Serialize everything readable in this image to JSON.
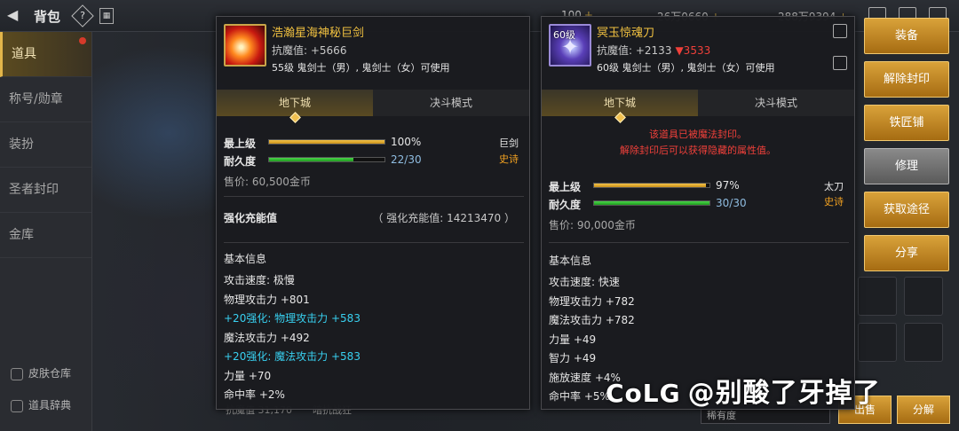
{
  "header": {
    "title": "背包",
    "help_glyph": "?",
    "currencies": [
      "100",
      "26万0660",
      "288万9394"
    ]
  },
  "sidebar": {
    "items": [
      {
        "label": "道具",
        "active": true
      },
      {
        "label": "称号/勋章"
      },
      {
        "label": "装扮"
      },
      {
        "label": "圣者封印"
      },
      {
        "label": "金库"
      }
    ],
    "bottom": [
      "皮肤仓库",
      "道具辞典"
    ]
  },
  "left_item": {
    "name": "浩瀚星海神秘巨剑",
    "magic_resist": "抗魔值: +5666",
    "requirement": "55级 鬼剑士（男）, 鬼剑士（女）可使用",
    "tab_active": "地下城",
    "tab_inactive": "决斗模式",
    "level_label": "最上级",
    "level_pct": "100%",
    "level_fill": 1.0,
    "durability_label": "耐久度",
    "durability": "22/30",
    "durability_fill": 0.7333,
    "weapon_type": "巨剑",
    "rarity": "史诗",
    "price": "售价: 60,500金币",
    "reinforce_label": "强化充能值",
    "reinforce_value": "（ 强化充能值: 14213470 ）",
    "basic_info": "基本信息",
    "stats": [
      {
        "text": "攻击速度: 极慢",
        "cyan": false
      },
      {
        "text": "物理攻击力 +801",
        "cyan": false
      },
      {
        "text": "+20强化: 物理攻击力 +583",
        "cyan": true
      },
      {
        "text": "魔法攻击力 +492",
        "cyan": false
      },
      {
        "text": "+20强化: 魔法攻击力 +583",
        "cyan": true
      },
      {
        "text": "力量 +70",
        "cyan": false
      },
      {
        "text": "命中率 +2%",
        "cyan": false
      }
    ]
  },
  "right_item": {
    "level_badge": "60级",
    "name": "冥玉惊魂刀",
    "magic_resist": "抗魔值: +2133",
    "magic_resist_diff": "▼3533",
    "requirement": "60级 鬼剑士（男）, 鬼剑士（女）可使用",
    "tab_active": "地下城",
    "tab_inactive": "决斗模式",
    "seal_warning_1": "该道具已被魔法封印。",
    "seal_warning_2": "解除封印后可以获得隐藏的属性值。",
    "level_label": "最上级",
    "level_pct": "97%",
    "level_fill": 0.97,
    "durability_label": "耐久度",
    "durability": "30/30",
    "durability_fill": 1.0,
    "weapon_type": "太刀",
    "rarity": "史诗",
    "price": "售价: 90,000金币",
    "basic_info": "基本信息",
    "stats": [
      "攻击速度: 快速",
      "物理攻击力 +782",
      "魔法攻击力 +782",
      "力量 +49",
      "智力 +49",
      "施放速度 +4%",
      "命中率 +5%"
    ]
  },
  "actions": [
    "装备",
    "解除封印",
    "铁匠铺",
    "修理",
    "获取途径",
    "分享"
  ],
  "bottom": {
    "hint_left": "抗魔值 31,170",
    "hint_mid": "暗抗战狂",
    "rarity_select": "稀有度",
    "sell_btn": "出售",
    "decompose_btn": "分解"
  },
  "watermark": {
    "logo": "CoLG",
    "text": "@别酸了牙掉了"
  },
  "colors": {
    "accent_gold": "#d9a23a",
    "item_name": "#f0c040",
    "enhance_cyan": "#38d0f0",
    "warning_red": "#f0403a",
    "rarity_epic": "#f0a020"
  }
}
